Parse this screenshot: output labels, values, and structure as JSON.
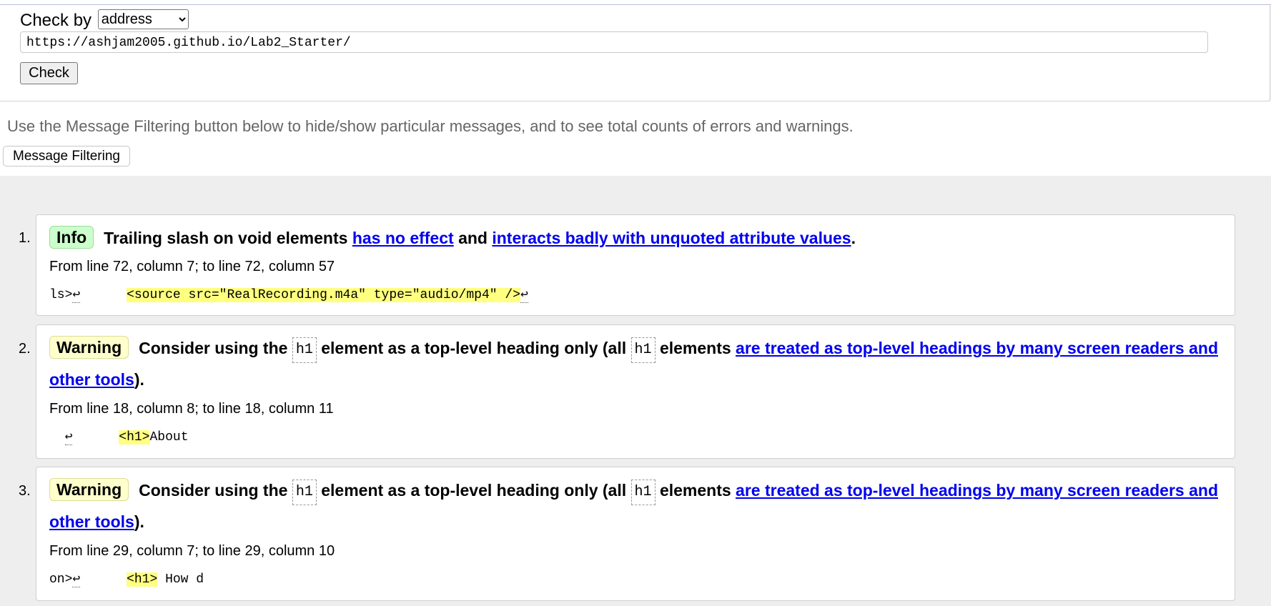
{
  "form": {
    "check_by_label": "Check by",
    "check_by_value": "address",
    "url_value": "https://ashjam2005.github.io/Lab2_Starter/",
    "check_button": "Check"
  },
  "filter": {
    "hint": "Use the Message Filtering button below to hide/show particular messages, and to see total counts of errors and warnings.",
    "button": "Message Filtering"
  },
  "messages": [
    {
      "number": "1.",
      "type": "Info",
      "text_a": "Trailing slash on void elements",
      "link_1": "has no effect",
      "text_b": "and",
      "link_2": "interacts badly with unquoted attribute values",
      "text_c": ".",
      "location": "From line 72, column 7; to line 72, column 57",
      "extract_pre": "ls>",
      "extract_highlight": "<source src=\"RealRecording.m4a\" type=\"audio/mp4\" />",
      "extract_post": ""
    },
    {
      "number": "2.",
      "type": "Warning",
      "text_a": "Consider using the",
      "code_1": "h1",
      "text_b": "element as a top-level heading only (all",
      "code_2": "h1",
      "text_c": "elements",
      "link_1": "are treated as top-level headings by many screen readers and other tools",
      "text_d": ").",
      "location": "From line 18, column 8; to line 18, column 11",
      "extract_pre": "",
      "extract_highlight": "<h1>",
      "extract_post": "About"
    },
    {
      "number": "3.",
      "type": "Warning",
      "text_a": "Consider using the",
      "code_1": "h1",
      "text_b": "element as a top-level heading only (all",
      "code_2": "h1",
      "text_c": "elements",
      "link_1": "are treated as top-level headings by many screen readers and other tools",
      "text_d": ").",
      "location": "From line 29, column 7; to line 29, column 10",
      "extract_pre": "on>",
      "extract_highlight": "<h1>",
      "extract_post": " How d"
    }
  ],
  "icons": {
    "return": "↩"
  }
}
